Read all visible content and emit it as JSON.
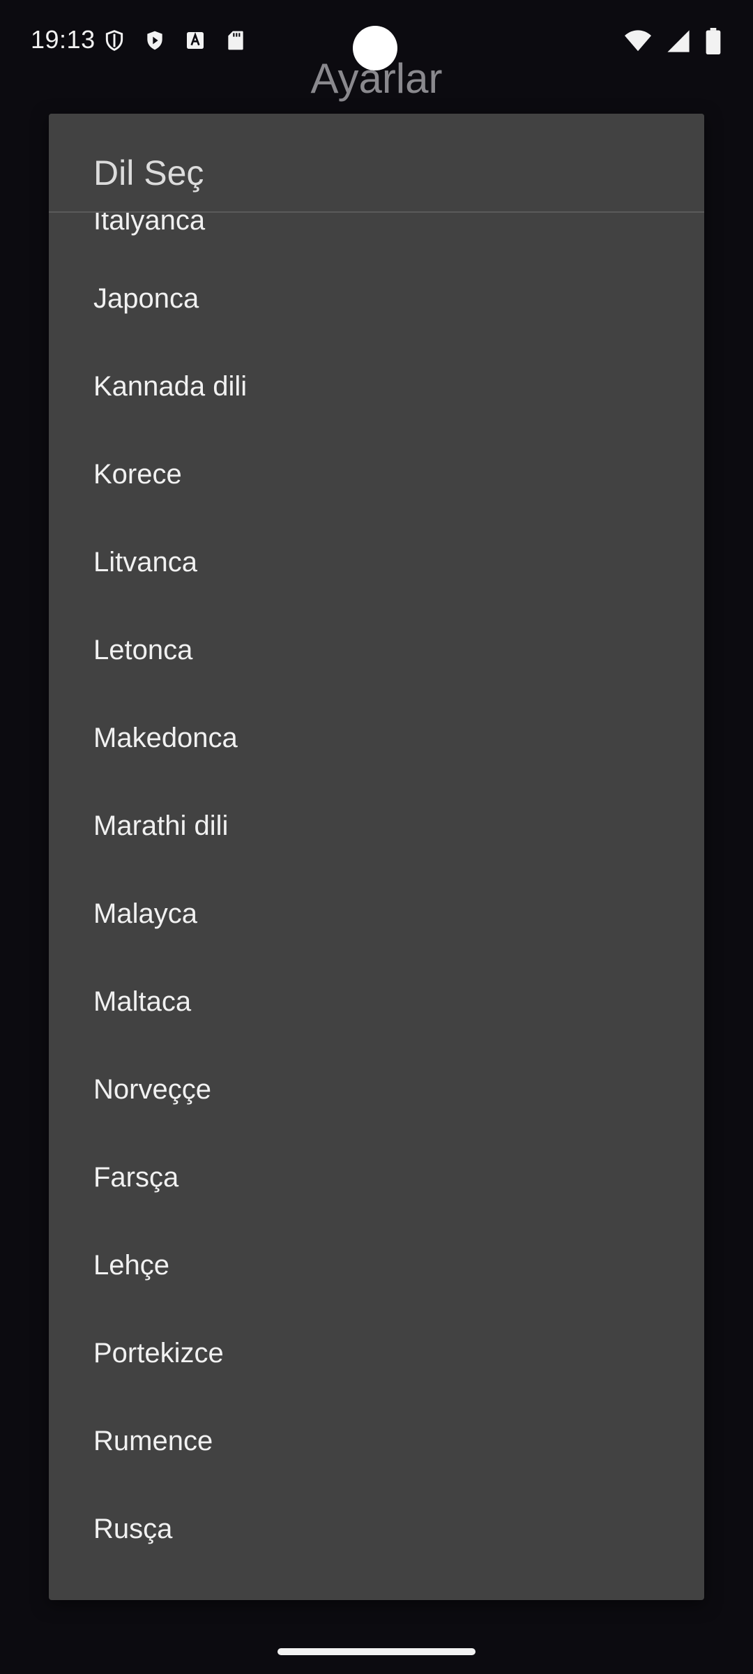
{
  "status_bar": {
    "time": "19:13",
    "left_icons": [
      "shield-icon",
      "play-protect-icon",
      "font-icon",
      "sd-card-icon"
    ],
    "right_icons": [
      "wifi-icon",
      "signal-icon",
      "battery-icon"
    ]
  },
  "app": {
    "title": "Ayarlar"
  },
  "dialog": {
    "title": "Dil Seç",
    "items": [
      {
        "label": "İtalyanca"
      },
      {
        "label": "Japonca"
      },
      {
        "label": "Kannada dili"
      },
      {
        "label": "Korece"
      },
      {
        "label": "Litvanca"
      },
      {
        "label": "Letonca"
      },
      {
        "label": "Makedonca"
      },
      {
        "label": "Marathi dili"
      },
      {
        "label": "Malayca"
      },
      {
        "label": "Maltaca"
      },
      {
        "label": "Norveççe"
      },
      {
        "label": "Farsça"
      },
      {
        "label": "Lehçe"
      },
      {
        "label": "Portekizce"
      },
      {
        "label": "Rumence"
      },
      {
        "label": "Rusça"
      }
    ]
  },
  "colors": {
    "background": "#0c0b10",
    "dialog": "#424242",
    "text": "#f1f1f1",
    "app_title": "#8a898e"
  }
}
